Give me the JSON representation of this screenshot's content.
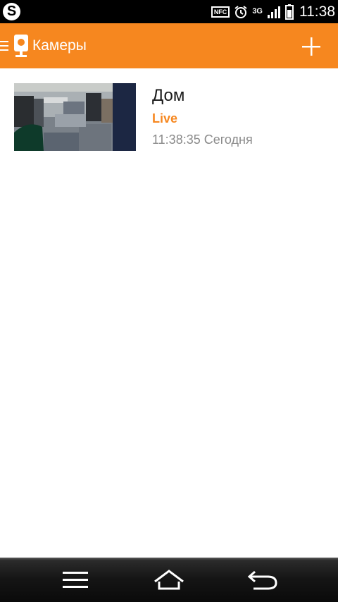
{
  "status_bar": {
    "time": "11:38",
    "nfc_label": "NFC",
    "network_label": "3G",
    "icons": [
      "skype-icon",
      "nfc-icon",
      "alarm-icon",
      "3g-icon",
      "signal-icon",
      "battery-icon"
    ]
  },
  "action_bar": {
    "title": "Камеры",
    "background_color": "#f6871f",
    "icons": [
      "menu-icon",
      "camera-logo-icon",
      "add-icon"
    ]
  },
  "cameras": [
    {
      "name": "Дом",
      "status": "Live",
      "last_updated": "11:38:35 Сегодня",
      "status_color": "#f6871f"
    }
  ],
  "nav_bar": {
    "icons": [
      "menu-icon",
      "home-icon",
      "back-icon"
    ]
  }
}
